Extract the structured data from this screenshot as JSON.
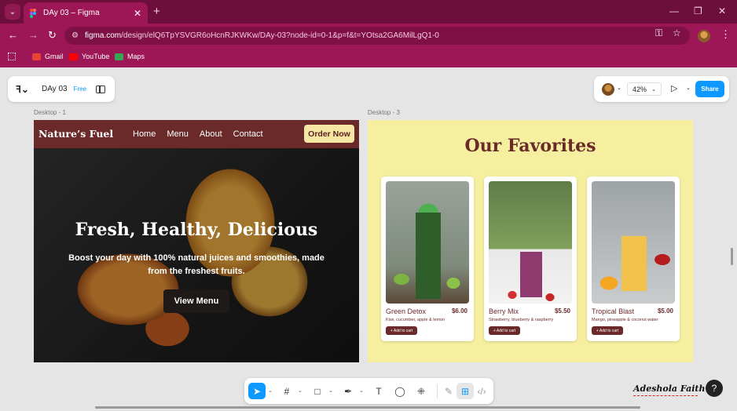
{
  "browser": {
    "tab_title": "DAy 03 – Figma",
    "url_host": "figma.com",
    "url_path": "/design/elQ6TpYSVGR6oHcnRJKWKw/DAy-03?node-id=0-1&p=f&t=YOtsa2GA6MilLgQ1-0",
    "bookmarks": [
      {
        "label": "Gmail",
        "color": "#ea4335"
      },
      {
        "label": "YouTube",
        "color": "#ff0000"
      },
      {
        "label": "Maps",
        "color": "#34a853"
      }
    ]
  },
  "figma": {
    "file_name": "DAy 03",
    "plan_badge": "Free",
    "zoom": "42%",
    "share_label": "Share",
    "frame1_label": "Desktop - 1",
    "frame3_label": "Desktop - 3",
    "accent": "#0d99ff"
  },
  "desktop1": {
    "brand": "Nature’s Fuel",
    "nav": [
      "Home",
      "Menu",
      "About",
      "Contact"
    ],
    "order_button": "Order Now",
    "hero_title": "Fresh, Healthy, Delicious",
    "hero_subtitle": "Boost your day with 100% natural juices and smoothies, made from the freshest fruits.",
    "cta": "View Menu"
  },
  "desktop3": {
    "title": "Our Favorites",
    "cards": [
      {
        "name": "Green Detox",
        "price": "$6.00",
        "desc": "Kiwi, cucumber, apple & lemon",
        "button": "+ Add to cart"
      },
      {
        "name": "Berry Mix",
        "price": "$5.50",
        "desc": "Strawberry, blueberry & raspberry",
        "button": "+ Add to cart"
      },
      {
        "name": "Tropical Blast",
        "price": "$5.00",
        "desc": "Mango, pineapple & coconut water",
        "button": "+ Add to cart"
      }
    ]
  },
  "signature": "Adeshola Faith",
  "help": "?"
}
